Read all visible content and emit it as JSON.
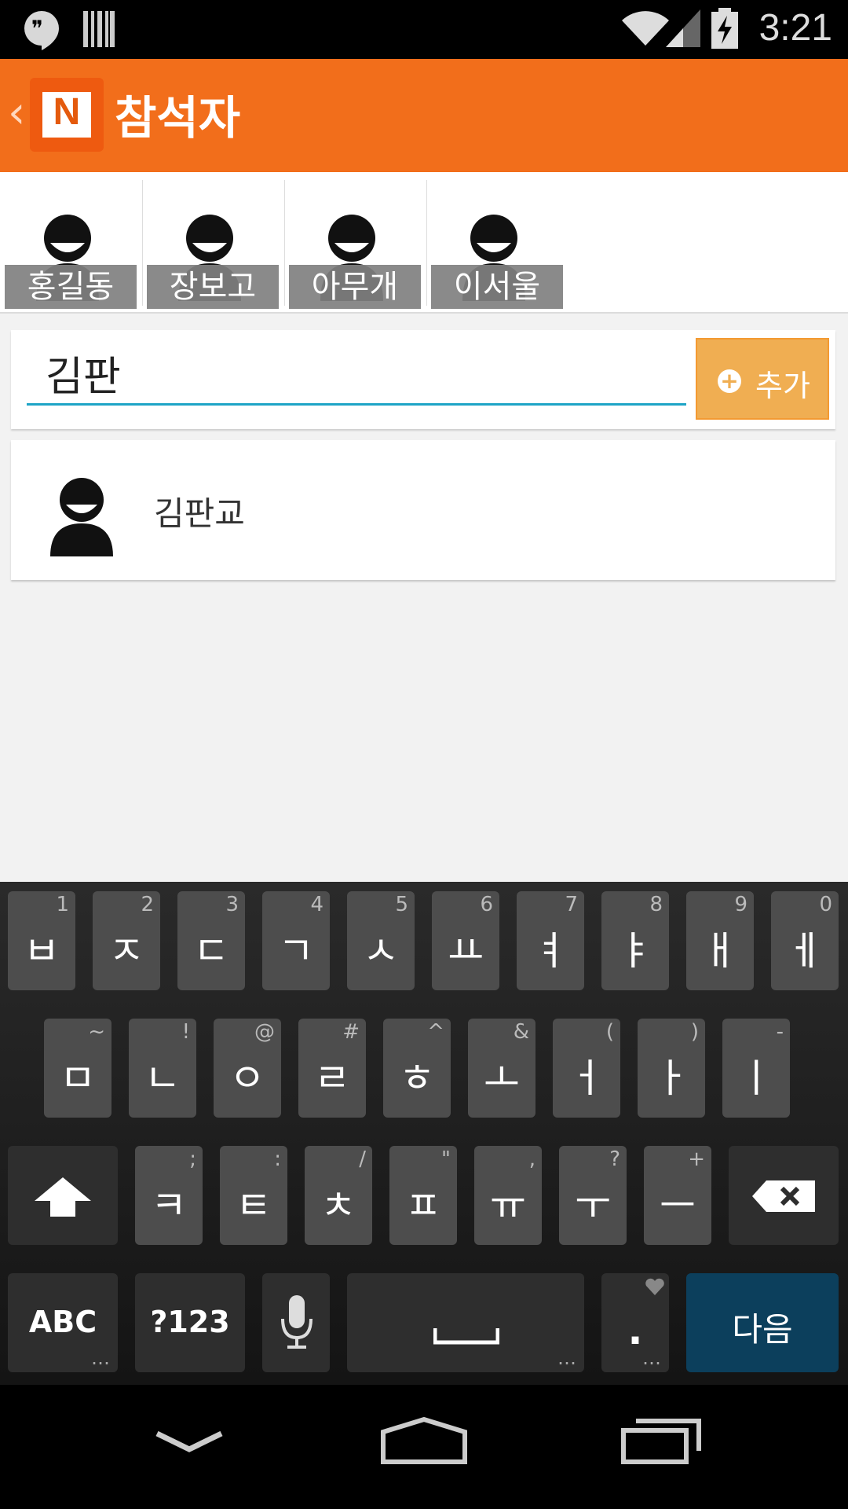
{
  "status_bar": {
    "time": "3:21"
  },
  "action_bar": {
    "title": "참석자",
    "logo_letter": "N"
  },
  "attendees": [
    "홍길동",
    "장보고",
    "아무개",
    "이서울"
  ],
  "search": {
    "value": "김판",
    "add_label": "추가"
  },
  "results": [
    {
      "name": "김판교"
    }
  ],
  "keyboard": {
    "row1": [
      [
        "ㅂ",
        "1"
      ],
      [
        "ㅈ",
        "2"
      ],
      [
        "ㄷ",
        "3"
      ],
      [
        "ㄱ",
        "4"
      ],
      [
        "ㅅ",
        "5"
      ],
      [
        "ㅛ",
        "6"
      ],
      [
        "ㅕ",
        "7"
      ],
      [
        "ㅑ",
        "8"
      ],
      [
        "ㅐ",
        "9"
      ],
      [
        "ㅔ",
        "0"
      ]
    ],
    "row2": [
      [
        "ㅁ",
        "~"
      ],
      [
        "ㄴ",
        "!"
      ],
      [
        "ㅇ",
        "@"
      ],
      [
        "ㄹ",
        "#"
      ],
      [
        "ㅎ",
        "^"
      ],
      [
        "ㅗ",
        "&"
      ],
      [
        "ㅓ",
        "("
      ],
      [
        "ㅏ",
        ")"
      ],
      [
        "ㅣ",
        "-"
      ]
    ],
    "row3": [
      [
        "ㅋ",
        ";"
      ],
      [
        "ㅌ",
        ":"
      ],
      [
        "ㅊ",
        "/"
      ],
      [
        "ㅍ",
        "\""
      ],
      [
        "ㅠ",
        ","
      ],
      [
        "ㅜ",
        "?"
      ],
      [
        "ㅡ",
        "+"
      ]
    ],
    "abc_label": "ABC",
    "sym_label": "?123",
    "period": ".",
    "ellipsis": "…",
    "enter_label": "다음"
  }
}
